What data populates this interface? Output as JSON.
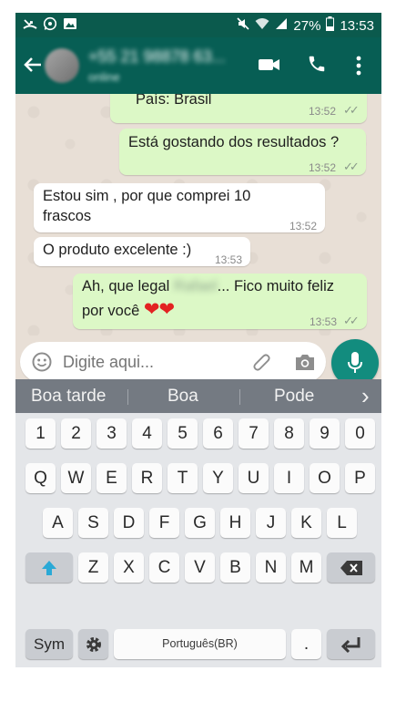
{
  "status": {
    "battery_percent": "27%",
    "time": "13:53"
  },
  "header": {
    "contact_name": "+55 21 98878 63...",
    "contact_status": "online"
  },
  "messages": [
    {
      "text": "País: Brasil",
      "time": "13:52",
      "direction": "out",
      "ticks": "✓✓"
    },
    {
      "text": "Está gostando dos resultados ?",
      "time": "13:52",
      "direction": "out",
      "ticks": "✓✓"
    },
    {
      "line1": "Estou sim , por que comprei 10",
      "line2": "frascos",
      "time": "13:52",
      "direction": "in"
    },
    {
      "text": "O produto excelente :)",
      "time": "13:53",
      "direction": "in"
    },
    {
      "line1_pre": "Ah, que legal ",
      "line1_blur": "Rafael",
      "line1_post": "... Fico muito feliz",
      "line2": "por você ",
      "hearts": "❤❤",
      "time": "13:53",
      "direction": "out",
      "ticks": "✓✓"
    }
  ],
  "composer": {
    "placeholder": "Digite aqui..."
  },
  "suggestions": {
    "items": [
      "Boa tarde",
      "Boa",
      "Pode"
    ],
    "more": "›"
  },
  "keyboard": {
    "row_numbers": [
      "1",
      "2",
      "3",
      "4",
      "5",
      "6",
      "7",
      "8",
      "9",
      "0"
    ],
    "row1": [
      "Q",
      "W",
      "E",
      "R",
      "T",
      "Y",
      "U",
      "I",
      "O",
      "P"
    ],
    "row2": [
      "A",
      "S",
      "D",
      "F",
      "G",
      "H",
      "J",
      "K",
      "L"
    ],
    "row3": [
      "Z",
      "X",
      "C",
      "V",
      "B",
      "N",
      "M"
    ],
    "sym": "Sym",
    "space": "Português(BR)",
    "period": "."
  },
  "colors": {
    "header": "#075e54",
    "statusbar": "#0b5a4d",
    "outgoing": "#dcf8c6",
    "incoming": "#ffffff",
    "mic_button": "#128c7e",
    "shift_arrow": "#2aa9d6"
  },
  "icons": {
    "status_left": [
      "missed-call-icon",
      "whatsapp-icon",
      "gallery-icon"
    ],
    "status_right": [
      "mute-icon",
      "wifi-icon",
      "signal-icon",
      "battery-icon"
    ],
    "appbar": [
      "back-arrow-icon",
      "avatar",
      "video-call-icon",
      "phone-call-icon",
      "more-vert-icon"
    ],
    "composer": [
      "emoji-icon",
      "attach-icon",
      "camera-icon",
      "mic-icon"
    ],
    "keyboard": [
      "shift-icon",
      "backspace-icon",
      "settings-icon",
      "enter-icon"
    ]
  }
}
